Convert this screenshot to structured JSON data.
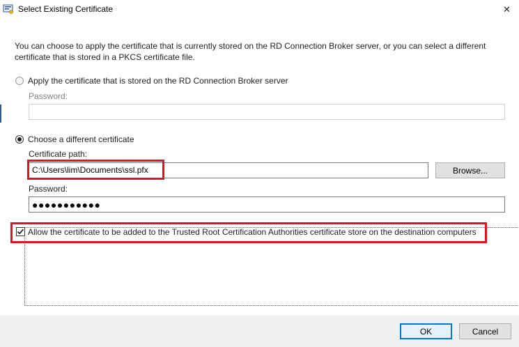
{
  "window": {
    "title": "Select Existing Certificate",
    "close_glyph": "✕",
    "icon": "certificate-app-icon"
  },
  "intro": "You can choose to apply the certificate that is currently stored on the RD Connection Broker server, or you can select a different certificate that is stored in a PKCS certificate file.",
  "option_server": {
    "label": "Apply the certificate that is stored on the RD Connection Broker server",
    "selected": false,
    "password_label": "Password:",
    "password_value": ""
  },
  "option_file": {
    "label": "Choose a different certificate",
    "selected": true,
    "path_label": "Certificate path:",
    "path_value": "C:\\Users\\lim\\Documents\\ssl.pfx",
    "browse_label": "Browse...",
    "password_label": "Password:",
    "password_value": "●●●●●●●●●●●"
  },
  "trust_checkbox": {
    "label": "Allow the certificate to be added to the Trusted Root Certification Authorities certificate store on the destination computers",
    "checked": true
  },
  "buttons": {
    "ok": "OK",
    "cancel": "Cancel"
  },
  "colors": {
    "highlight": "#e0141e",
    "default_button_border": "#0078d7"
  }
}
